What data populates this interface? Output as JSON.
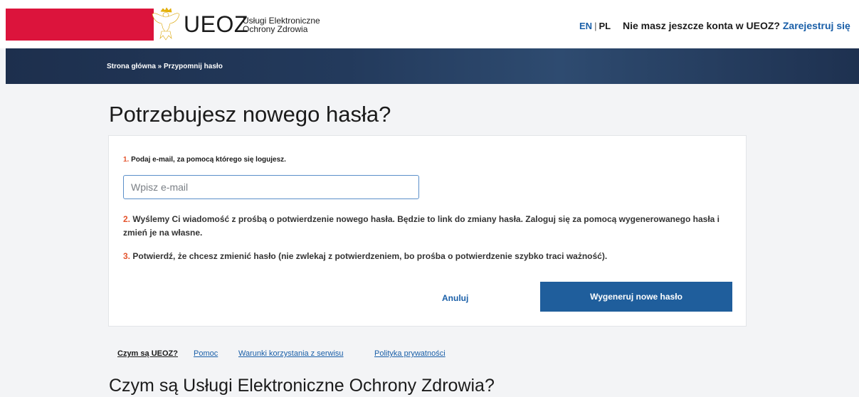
{
  "header": {
    "logo_text": "UEOZ",
    "logo_sub_line1": "Usługi Elektroniczne",
    "logo_sub_line2": "Ochrony Zdrowia",
    "lang_en": "EN",
    "lang_sep": "|",
    "lang_pl": "PL",
    "account_prompt": "Nie masz jeszcze konta w UEOZ?",
    "register_link": "Zarejestruj się",
    "brand_red": "#dc143c"
  },
  "breadcrumb": "Strona główna » Przypomnij hasło",
  "main": {
    "title": "Potrzebujesz nowego hasła?",
    "step1_num": "1.",
    "step1_text": "Podaj e-mail, za pomocą którego się logujesz.",
    "email_placeholder": "Wpisz e-mail",
    "step2_num": "2.",
    "step2_text": "Wyślemy Ci wiadomość z prośbą o potwierdzenie nowego hasła. Będzie to link do zmiany hasła. Zaloguj się za pomocą wygenerowanego hasła i zmień je na własne.",
    "step3_num": "3.",
    "step3_text": "Potwierdź, że chcesz zmienić hasło (nie zwlekaj z potwierdzeniem, bo prośba o potwierdzenie szybko traci ważność).",
    "cancel_label": "Anuluj",
    "generate_label": "Wygeneruj nowe hasło"
  },
  "footer_links": [
    "Czym są UEOZ?",
    "Pomoc",
    "Warunki korzystania z serwisu",
    "Polityka prywatności"
  ],
  "bottom_title": "Czym są Usługi Elektroniczne Ochrony Zdrowia?"
}
